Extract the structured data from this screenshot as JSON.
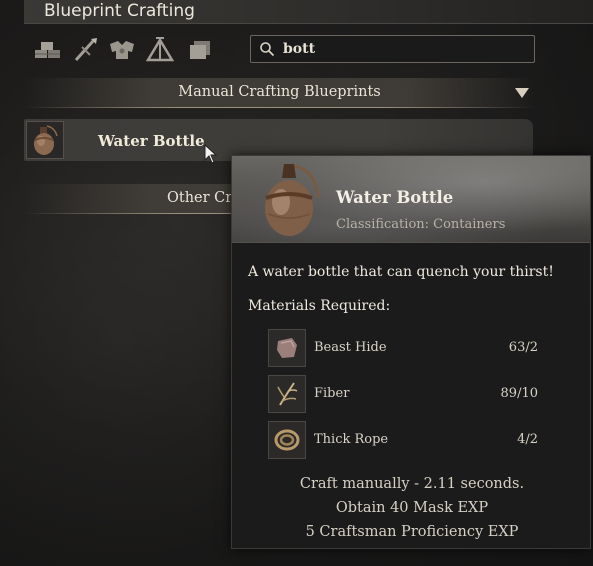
{
  "window": {
    "title": "Blueprint Crafting"
  },
  "categories": [
    {
      "icon": "building-blocks-icon"
    },
    {
      "icon": "weapon-tools-icon"
    },
    {
      "icon": "armor-icon"
    },
    {
      "icon": "camp-tent-icon"
    },
    {
      "icon": "materials-stack-icon"
    }
  ],
  "search": {
    "value": "bott",
    "placeholder": ""
  },
  "sections": {
    "manual": {
      "label": "Manual Crafting Blueprints"
    },
    "other": {
      "label": "Other Cr"
    }
  },
  "recipes": [
    {
      "name": "Water Bottle",
      "icon": "water-bottle-icon"
    }
  ],
  "tooltip": {
    "name": "Water Bottle",
    "classification": "Classification: Containers",
    "description": "A water bottle that can quench your thirst!",
    "materials_title": "Materials Required:",
    "materials": [
      {
        "name": "Beast Hide",
        "count": "63/2",
        "icon": "beast-hide-icon"
      },
      {
        "name": "Fiber",
        "count": "89/10",
        "icon": "fiber-icon"
      },
      {
        "name": "Thick Rope",
        "count": "4/2",
        "icon": "thick-rope-icon"
      }
    ],
    "footer": [
      "Craft manually - 2.11 seconds.",
      "Obtain 40 Mask EXP",
      "5 Craftsman Proficiency EXP"
    ]
  },
  "colors": {
    "text_primary": "#f0eadf",
    "text_secondary": "#b8b2a7",
    "panel_bg": "#1b1b1b",
    "accent_line": "#9a917f"
  }
}
